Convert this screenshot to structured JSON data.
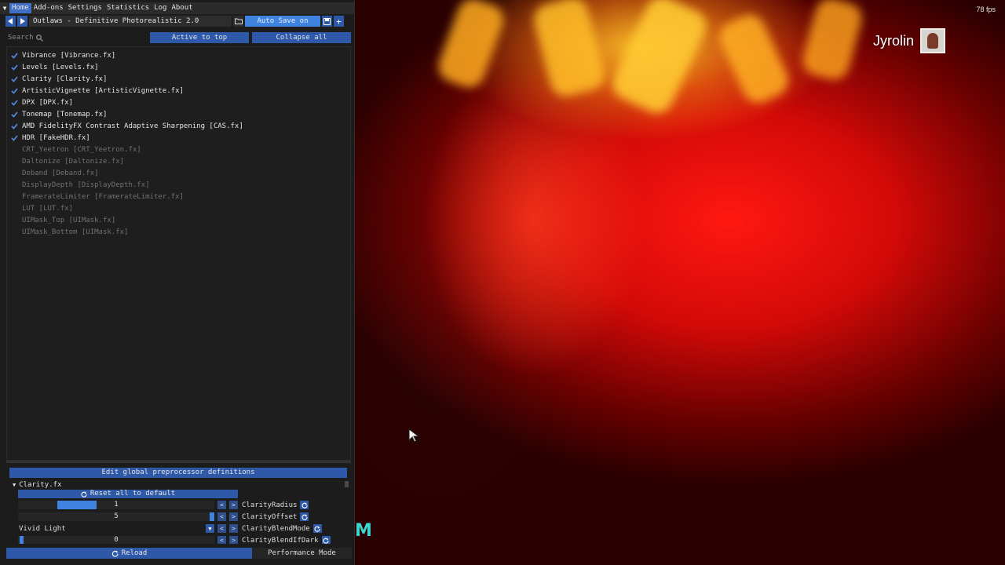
{
  "overlay": {
    "fps": "78 fps",
    "streamer_name": "Jyrolin",
    "corner_logo": "M"
  },
  "menu": {
    "items": [
      "Home",
      "Add-ons",
      "Settings",
      "Statistics",
      "Log",
      "About"
    ],
    "active": "Home"
  },
  "preset": {
    "name": "Outlaws - Definitive Photorealistic 2.0",
    "auto_save_label": "Auto Save on"
  },
  "search": {
    "placeholder": "Search"
  },
  "toolbar": {
    "active_to_top": "Active to top",
    "collapse_all": "Collapse all"
  },
  "effects": [
    {
      "label": "Vibrance [Vibrance.fx]",
      "enabled": true
    },
    {
      "label": "Levels [Levels.fx]",
      "enabled": true
    },
    {
      "label": "Clarity [Clarity.fx]",
      "enabled": true
    },
    {
      "label": "ArtisticVignette [ArtisticVignette.fx]",
      "enabled": true
    },
    {
      "label": "DPX [DPX.fx]",
      "enabled": true
    },
    {
      "label": "Tonemap [Tonemap.fx]",
      "enabled": true
    },
    {
      "label": "AMD FidelityFX Contrast Adaptive Sharpening [CAS.fx]",
      "enabled": true
    },
    {
      "label": "HDR [FakeHDR.fx]",
      "enabled": true
    },
    {
      "label": "CRT_Yeetron [CRT_Yeetron.fx]",
      "enabled": false
    },
    {
      "label": "Daltonize [Daltonize.fx]",
      "enabled": false
    },
    {
      "label": "Deband [Deband.fx]",
      "enabled": false
    },
    {
      "label": "DisplayDepth [DisplayDepth.fx]",
      "enabled": false
    },
    {
      "label": "FramerateLimiter [FramerateLimiter.fx]",
      "enabled": false
    },
    {
      "label": "LUT [LUT.fx]",
      "enabled": false
    },
    {
      "label": "UIMask_Top [UIMask.fx]",
      "enabled": false
    },
    {
      "label": "UIMask_Bottom [UIMask.fx]",
      "enabled": false
    }
  ],
  "preprocessor": {
    "button_label": "Edit global preprocessor definitions"
  },
  "parameters": {
    "section_title": "Clarity.fx",
    "reset_label": "Reset all to default",
    "rows": [
      {
        "name": "ClarityRadius",
        "value": "1",
        "kind": "slider",
        "fill": 0.2
      },
      {
        "name": "ClarityOffset",
        "value": "5",
        "kind": "slider",
        "fill": 0.975
      },
      {
        "name": "ClarityBlendMode",
        "value": "Vivid Light",
        "kind": "combo"
      },
      {
        "name": "ClarityBlendIfDark",
        "value": "0",
        "kind": "slider",
        "fill": 0.02
      }
    ]
  },
  "footer": {
    "reload": "Reload",
    "performance_mode": "Performance Mode"
  },
  "colors": {
    "accent": "#3f82e0",
    "button": "#2e58a8",
    "panel_bg": "#1c1c1c"
  }
}
